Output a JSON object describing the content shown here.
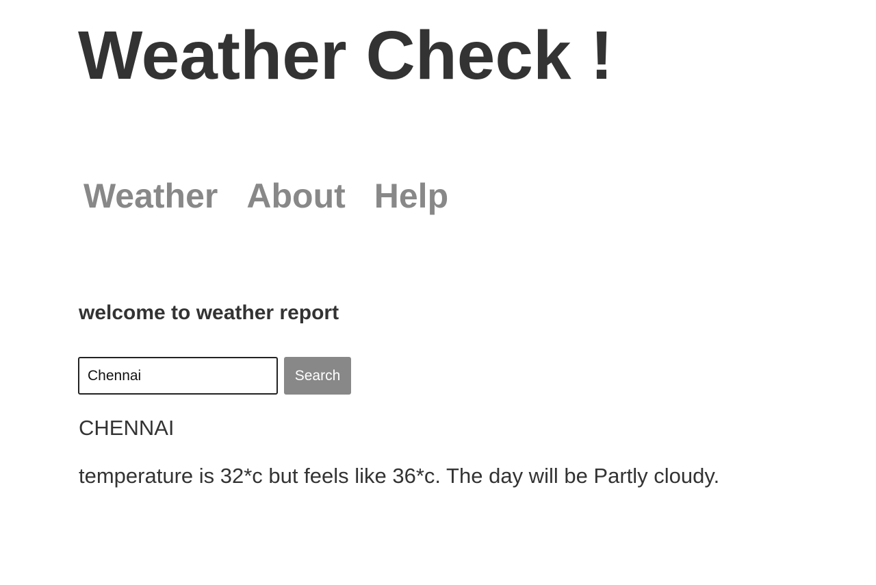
{
  "header": {
    "title": "Weather Check !"
  },
  "nav": {
    "items": [
      {
        "label": "Weather"
      },
      {
        "label": "About"
      },
      {
        "label": "Help"
      }
    ]
  },
  "main": {
    "welcome": "welcome to weather report",
    "search": {
      "value": "Chennai",
      "button_label": "Search"
    },
    "result": {
      "location": "CHENNAI",
      "forecast": "temperature is 32*c but feels like 36*c. The day will be Partly cloudy."
    }
  },
  "colors": {
    "text": "#333333",
    "nav_link": "#888888",
    "button_bg": "#888888",
    "button_text": "#ffffff"
  }
}
